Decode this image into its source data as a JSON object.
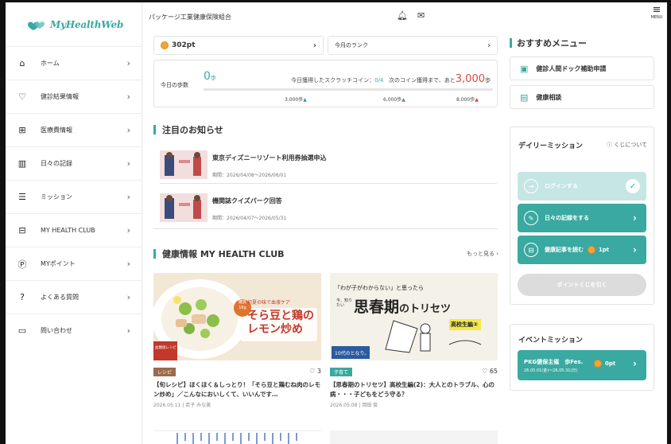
{
  "app": {
    "logo_text": "MyHealthWeb",
    "org": "パッケージ工業健康保険組合",
    "menu_label": "MENU"
  },
  "sidebar": {
    "items": [
      {
        "label": "ホーム",
        "icon": "home-icon",
        "glyph": "⌂"
      },
      {
        "label": "健診結果情報",
        "icon": "stethoscope-icon",
        "glyph": "♡"
      },
      {
        "label": "医療費情報",
        "icon": "medical-cross-icon",
        "glyph": "⊞"
      },
      {
        "label": "日々の記録",
        "icon": "bar-chart-icon",
        "glyph": "▥"
      },
      {
        "label": "ミッション",
        "icon": "checklist-icon",
        "glyph": "☰"
      },
      {
        "label": "MY HEALTH CLUB",
        "icon": "book-icon",
        "glyph": "⊟"
      },
      {
        "label": "MYポイント",
        "icon": "point-icon",
        "glyph": "Ⓟ"
      },
      {
        "label": "よくある質問",
        "icon": "question-icon",
        "glyph": "?"
      },
      {
        "label": "問い合わせ",
        "icon": "chat-icon",
        "glyph": "▭"
      }
    ]
  },
  "points": {
    "value": "302pt",
    "rank_label": "今月のランク"
  },
  "steps": {
    "label": "今日の歩数",
    "count": "0",
    "unit": "歩",
    "earned_label": "今日獲得したスクラッチコイン：",
    "earned": "0/4",
    "next_label": "次のコイン獲得まで、あと",
    "next_value": "3,000",
    "next_unit": "歩",
    "milestones": [
      "3,000歩",
      "6,000歩",
      "8,000歩"
    ],
    "progress": 0
  },
  "notices": {
    "title": "注目のお知らせ",
    "items": [
      {
        "title": "東京ディズニーリゾート利用券抽選申込",
        "period": "期間：2026/04/08〜2026/06/01"
      },
      {
        "title": "機関誌クイズパーク回答",
        "period": "期間：2026/04/07〜2026/05/31"
      }
    ]
  },
  "club": {
    "title": "健康情報 MY HEALTH CLUB",
    "more": "もっと見る ›",
    "cards": [
      {
        "tag": "レシピ",
        "tag_color": "#9b6b4b",
        "likes": "3",
        "title": "【旬レシピ】ほくほく＆しっとり！「そら豆と鶏むね肉のレモン炒め」／こんなにおいしくて、いいんです…",
        "meta": "2026.05.11 | 若子 みな美",
        "img_text1": "そら豆と鶏の",
        "img_text2": "レモン炒め",
        "img_sub": "初夏の味で血液ケア",
        "img_badge1": "糖質",
        "img_badge2": "16g",
        "img_brand": "血糖値レシピ"
      },
      {
        "tag": "子育て",
        "tag_color": "#3aa9a1",
        "likes": "65",
        "title": "【思春期のトリセツ】高校生編(2)：大人とのトラブル、心の病・・・子どもをどう守る？",
        "meta": "2026.05.08 | 岡田 俊",
        "img_text1": "「わが子がわからない」と思ったら",
        "img_text2": "思春期",
        "img_text3": "のトリセツ",
        "img_sub": "高校生編②",
        "img_foot": "10代のとなり。",
        "img_pre": "今、知りたい"
      }
    ]
  },
  "recommend": {
    "title": "おすすめメニュー",
    "items": [
      {
        "label": "健診人間ドック補助申請",
        "icon": "calendar-icon",
        "glyph": "▣"
      },
      {
        "label": "健康相談",
        "icon": "document-icon",
        "glyph": "▤"
      }
    ]
  },
  "daily": {
    "title": "デイリーミッション",
    "link": "くじについて",
    "login": "ログインする",
    "record": "日々の記録をする",
    "read": "健康記事を読む",
    "read_pt": "1pt",
    "lottery": "ポイントくじを引く"
  },
  "event": {
    "title": "イベントミッション",
    "name": "PKG健保主催　歩Fes.",
    "period": "26.05.01(金)〜26.05.31(日)",
    "pt": "0pt"
  },
  "colors": {
    "accent": "#3aa9a1",
    "accent_light": "#c5e6e3",
    "disabled": "#dcdcdc"
  }
}
